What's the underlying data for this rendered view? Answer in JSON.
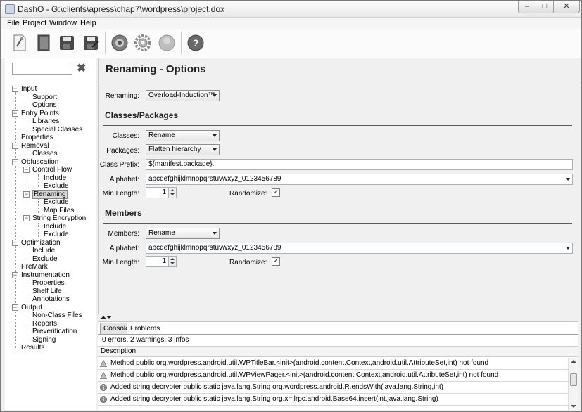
{
  "window": {
    "title": "DashO - G:\\clients\\apress\\chap7\\wordpress\\project.dox",
    "min_glyph": "–",
    "max_glyph": "□",
    "close_glyph": "✕"
  },
  "menu": [
    "File",
    "Project",
    "Window",
    "Help"
  ],
  "toolbar": {
    "icons": [
      "new-project-icon",
      "open-project-icon",
      "save-icon",
      "save-as-icon",
      "build-icon",
      "options-gear-icon",
      "run-icon",
      "help-icon"
    ],
    "help_glyph": "?"
  },
  "sidebar": {
    "search_placeholder": "",
    "clear_glyph": "✖",
    "tree": [
      {
        "label": "Input",
        "expander": "−"
      },
      {
        "label": "Support"
      },
      {
        "label": "Options"
      },
      {
        "label": "Entry Points",
        "expander": "−"
      },
      {
        "label": "Libraries"
      },
      {
        "label": "Special Classes"
      },
      {
        "label": "Properties"
      },
      {
        "label": "Removal",
        "expander": "−"
      },
      {
        "label": "Classes"
      },
      {
        "label": "Obfuscation",
        "expander": "−"
      },
      {
        "label": "Control Flow",
        "expander": "−"
      },
      {
        "label": "Include"
      },
      {
        "label": "Exclude"
      },
      {
        "label": "Renaming",
        "expander": "−",
        "selected": true
      },
      {
        "label": "Exclude"
      },
      {
        "label": "Map Files"
      },
      {
        "label": "String Encryption",
        "expander": "−"
      },
      {
        "label": "Include"
      },
      {
        "label": "Exclude"
      },
      {
        "label": "Optimization",
        "expander": "−"
      },
      {
        "label": "Include"
      },
      {
        "label": "Exclude"
      },
      {
        "label": "PreMark"
      },
      {
        "label": "Instrumentation",
        "expander": "−"
      },
      {
        "label": "Properties"
      },
      {
        "label": "Shelf Life"
      },
      {
        "label": "Annotations"
      },
      {
        "label": "Output",
        "expander": "−"
      },
      {
        "label": "Non-Class Files"
      },
      {
        "label": "Reports"
      },
      {
        "label": "Preverification"
      },
      {
        "label": "Signing"
      },
      {
        "label": "Results"
      }
    ]
  },
  "main": {
    "title": "Renaming - Options",
    "renaming_label": "Renaming:",
    "renaming_value": "Overload-Induction™",
    "classes_section": {
      "heading": "Classes/Packages",
      "classes_label": "Classes:",
      "classes_value": "Rename",
      "packages_label": "Packages:",
      "packages_value": "Flatten hierarchy",
      "prefix_label": "Class Prefix:",
      "prefix_value": "${manifest.package}.",
      "alphabet_label": "Alphabet:",
      "alphabet_value": "abcdefghijklmnopqrstuvwxyz_0123456789",
      "min_length_label": "Min Length:",
      "min_length_value": "1",
      "randomize_label": "Randomize:",
      "randomize_mark": "✓"
    },
    "members_section": {
      "heading": "Members",
      "members_label": "Members:",
      "members_value": "Rename",
      "alphabet_label": "Alphabet:",
      "alphabet_value": "abcdefghijklmnopqrstuvwxyz_0123456789",
      "min_length_label": "Min Length:",
      "min_length_value": "1",
      "randomize_label": "Randomize:",
      "randomize_mark": "✓"
    }
  },
  "bottom": {
    "tabs": [
      "Console",
      "Problems"
    ],
    "active_tab": "Problems",
    "summary": "0 errors, 2 warnings, 3 infos",
    "column_header": "Description",
    "rows": [
      {
        "icon": "warning-icon",
        "text": "Method public org.wordpress.android.util.WPTitleBar.<init>(android.content.Context,android.util.AttributeSet,int) not found"
      },
      {
        "icon": "warning-icon",
        "text": "Method public org.wordpress.android.util.WPViewPager.<init>(android.content.Context,android.util.AttributeSet,int) not found"
      },
      {
        "icon": "info-icon",
        "text": "Added string decrypter public static java.lang.String org.wordpress.android.R.endsWith(java.lang.String,int)"
      },
      {
        "icon": "info-icon",
        "text": "Added string decrypter public static java.lang.String org.xmlrpc.android.Base64.insert(int,java.lang.String)"
      }
    ]
  }
}
